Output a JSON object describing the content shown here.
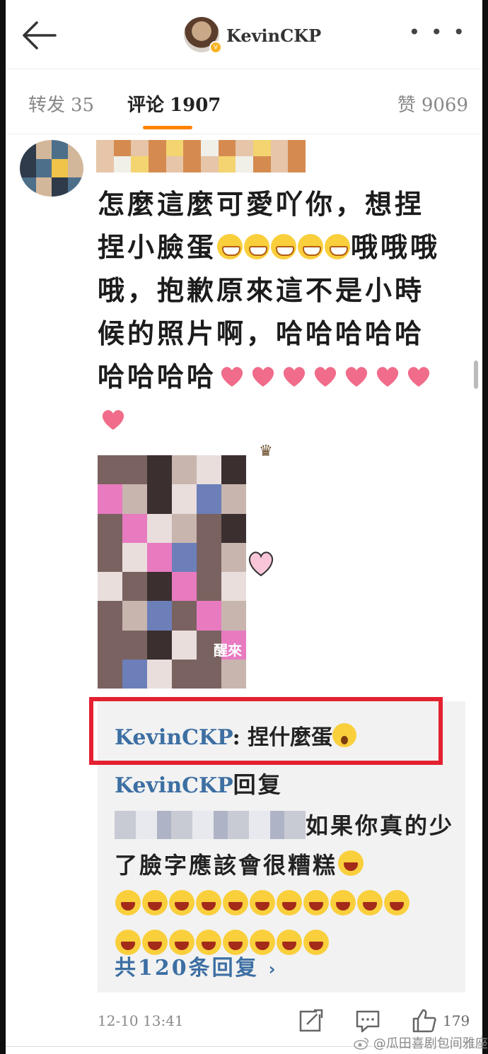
{
  "header": {
    "title": "KevinCKP",
    "more": "• • •"
  },
  "tabs": {
    "repost_label": "转发",
    "repost_count": "35",
    "comments_label": "评论",
    "comments_count": "1907",
    "likes_label": "赞",
    "likes_count": "9069"
  },
  "comment": {
    "text_part1": "怎麼這麼可愛吖你，想捏捏小臉蛋",
    "text_part2": "哦哦哦哦，抱歉原來這不是小時候的照片啊，哈哈哈哈哈哈哈哈哈",
    "photo_caption": "醒來",
    "time": "12-10 13:41",
    "like_count": "179"
  },
  "replies": {
    "first_user": "KevinCKP",
    "first_sep": ": ",
    "first_text": "捏什麼蛋",
    "second_user": "KevinCKP",
    "second_verb": "回复",
    "second_text": "如果你真的少了臉字應該會很糟糕",
    "more_label": "共120条回复",
    "more_chevron": "›"
  },
  "watermark": "@瓜田喜剧包间雅座",
  "colors": {
    "accent_orange": "#ff8200",
    "link_blue": "#3d6fa3",
    "highlight_red": "#e32130"
  }
}
